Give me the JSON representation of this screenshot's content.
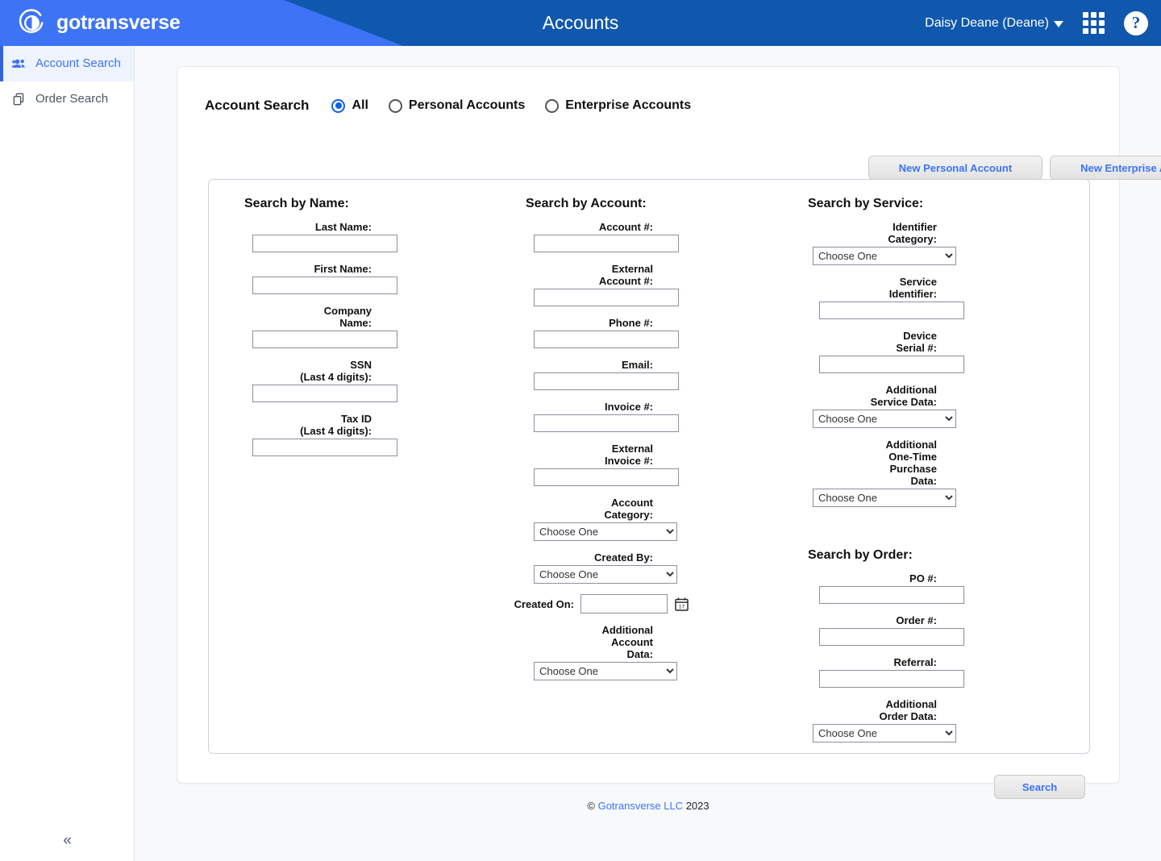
{
  "header": {
    "brand": "gotransverse",
    "logo_icon": "gotransverse-logo-icon",
    "page_title": "Accounts",
    "user_name": "Daisy Deane (Deane)",
    "apps_icon": "grid-apps-icon",
    "help_icon": "help-question-icon",
    "accent_color": "#3d74f5",
    "bar_color": "#1058ad"
  },
  "sidebar": {
    "items": [
      {
        "label": "Account Search",
        "icon": "users-group-icon",
        "active": true
      },
      {
        "label": "Order Search",
        "icon": "copy-pages-icon",
        "active": false
      }
    ],
    "collapse_label": "«",
    "collapse_icon": "chevron-double-left-icon"
  },
  "search_mode": {
    "title": "Account Search",
    "options": [
      {
        "label": "All",
        "selected": true
      },
      {
        "label": "Personal Accounts",
        "selected": false
      },
      {
        "label": "Enterprise Accounts",
        "selected": false
      }
    ],
    "new_personal_label": "New Personal Account",
    "new_enterprise_label": "New Enterprise Account"
  },
  "sections": {
    "name": {
      "title": "Search by Name:",
      "fields": [
        {
          "label": "Last Name:",
          "type": "text",
          "value": ""
        },
        {
          "label": "First Name:",
          "type": "text",
          "value": ""
        },
        {
          "label": "Company\nName:",
          "type": "text",
          "value": ""
        },
        {
          "label": "SSN\n(Last 4 digits):",
          "type": "text",
          "value": ""
        },
        {
          "label": "Tax ID\n(Last 4 digits):",
          "type": "text",
          "value": ""
        }
      ]
    },
    "account": {
      "title": "Search by Account:",
      "fields": [
        {
          "label": "Account #:",
          "type": "text",
          "value": ""
        },
        {
          "label": "External\nAccount #:",
          "type": "text",
          "value": ""
        },
        {
          "label": "Phone #:",
          "type": "text",
          "value": ""
        },
        {
          "label": "Email:",
          "type": "text",
          "value": ""
        },
        {
          "label": "Invoice #:",
          "type": "text",
          "value": ""
        },
        {
          "label": "External\nInvoice #:",
          "type": "text",
          "value": ""
        },
        {
          "label": "Account\nCategory:",
          "type": "select",
          "value": "Choose One"
        },
        {
          "label": "Created By:",
          "type": "select",
          "value": "Choose One"
        },
        {
          "label": "Created On:",
          "type": "date",
          "value": "",
          "icon": "calendar-icon"
        },
        {
          "label": "Additional\nAccount\nData:",
          "type": "select",
          "value": "Choose One"
        }
      ]
    },
    "service": {
      "title": "Search by Service:",
      "fields": [
        {
          "label": "Identifier\nCategory:",
          "type": "select",
          "value": "Choose One"
        },
        {
          "label": "Service\nIdentifier:",
          "type": "text",
          "value": ""
        },
        {
          "label": "Device\nSerial #:",
          "type": "text",
          "value": ""
        },
        {
          "label": "Additional\nService Data:",
          "type": "select",
          "value": "Choose One"
        },
        {
          "label": "Additional\nOne-Time\nPurchase\nData:",
          "type": "select",
          "value": "Choose One"
        }
      ]
    },
    "order": {
      "title": "Search by Order:",
      "fields": [
        {
          "label": "PO #:",
          "type": "text",
          "value": ""
        },
        {
          "label": "Order #:",
          "type": "text",
          "value": ""
        },
        {
          "label": "Referral:",
          "type": "text",
          "value": ""
        },
        {
          "label": "Additional\nOrder Data:",
          "type": "select",
          "value": "Choose One"
        }
      ]
    }
  },
  "actions": {
    "search_label": "Search"
  },
  "footer": {
    "symbol": "©",
    "link": "Gotransverse LLC",
    "year": "2023"
  }
}
